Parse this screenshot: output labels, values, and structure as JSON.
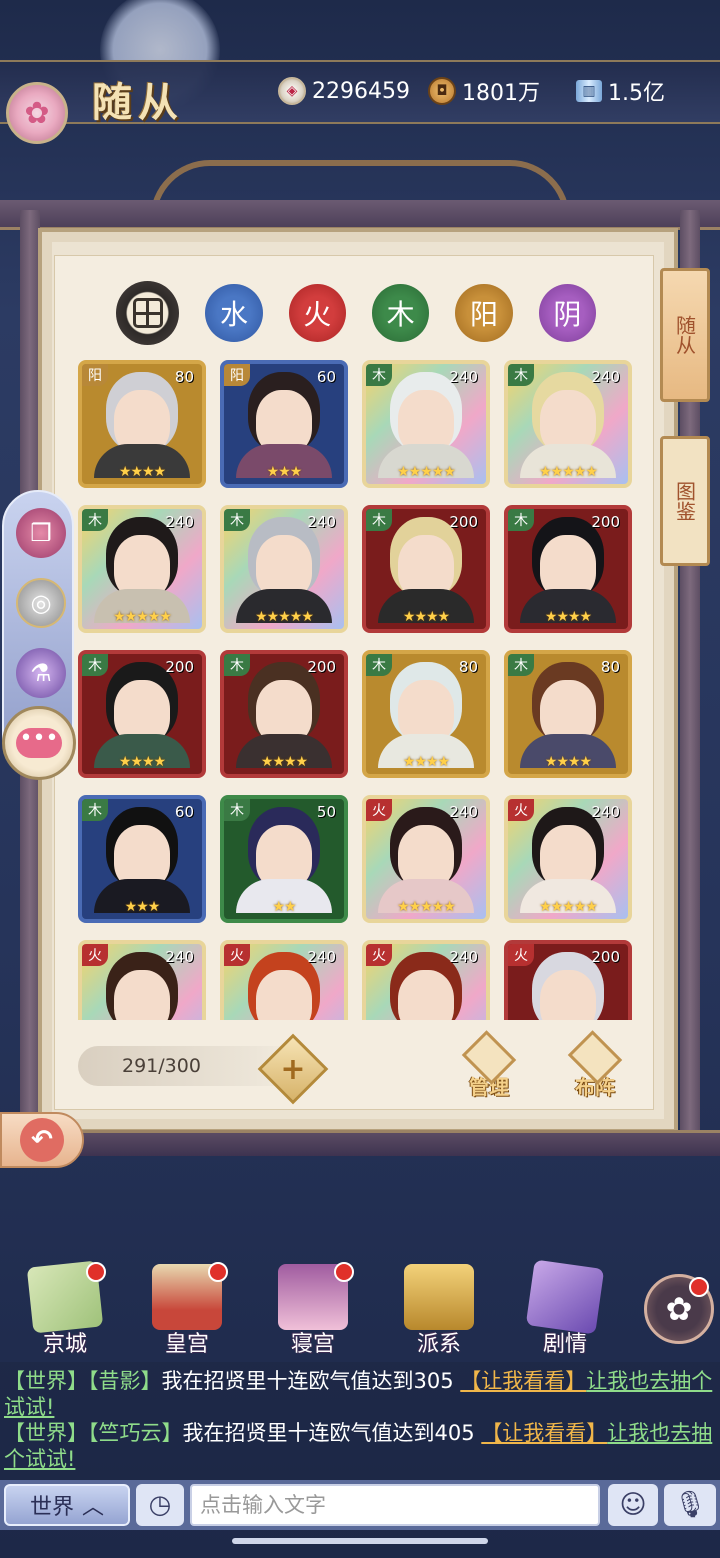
{
  "header": {
    "title": "随从",
    "resources": [
      {
        "icon": "yuanbao-icon",
        "value": "2296459"
      },
      {
        "icon": "copper-coin-icon",
        "value": "1801万"
      },
      {
        "icon": "book-icon",
        "value": "1.5亿"
      }
    ]
  },
  "filters": [
    {
      "id": "all",
      "label": ""
    },
    {
      "id": "water",
      "label": "水"
    },
    {
      "id": "fire",
      "label": "火"
    },
    {
      "id": "wood",
      "label": "木"
    },
    {
      "id": "yang",
      "label": "阳"
    },
    {
      "id": "yin",
      "label": "阴"
    }
  ],
  "side_tabs": {
    "retinue": "随从",
    "atlas": "图鉴"
  },
  "heroes": [
    {
      "element": "阳",
      "level": "80",
      "stars": "★★★★",
      "frame": "gold",
      "hair": "#cfcfd4",
      "robe": "#3a3a3a"
    },
    {
      "element": "阳",
      "level": "60",
      "stars": "★★★",
      "frame": "blue",
      "hair": "#2a1f1f",
      "robe": "#7a4a6a"
    },
    {
      "element": "木",
      "level": "240",
      "stars": "★★★★★",
      "frame": "rainbow",
      "hair": "#e8ecec",
      "robe": "#d8d8d0"
    },
    {
      "element": "木",
      "level": "240",
      "stars": "★★★★★",
      "frame": "rainbow",
      "hair": "#e6d9a0",
      "robe": "#e8e4d8"
    },
    {
      "element": "木",
      "level": "240",
      "stars": "★★★★★",
      "frame": "rainbow",
      "hair": "#1f1a1a",
      "robe": "#c8c0b0"
    },
    {
      "element": "木",
      "level": "240",
      "stars": "★★★★★",
      "frame": "rainbow",
      "hair": "#b8bcc4",
      "robe": "#2a2a2e"
    },
    {
      "element": "木",
      "level": "200",
      "stars": "★★★★",
      "frame": "red",
      "hair": "#e2d29a",
      "robe": "#2a2a2a"
    },
    {
      "element": "木",
      "level": "200",
      "stars": "★★★★",
      "frame": "red",
      "hair": "#141418",
      "robe": "#2a2a30"
    },
    {
      "element": "木",
      "level": "200",
      "stars": "★★★★",
      "frame": "red",
      "hair": "#1a1a1a",
      "robe": "#3a5a4a"
    },
    {
      "element": "木",
      "level": "200",
      "stars": "★★★★",
      "frame": "red",
      "hair": "#4a3022",
      "robe": "#3a3030"
    },
    {
      "element": "木",
      "level": "80",
      "stars": "★★★★",
      "frame": "gold",
      "hair": "#dfe8e8",
      "robe": "#e8e8e0"
    },
    {
      "element": "木",
      "level": "80",
      "stars": "★★★★",
      "frame": "gold",
      "hair": "#6a3a22",
      "robe": "#4a4a6a"
    },
    {
      "element": "木",
      "level": "60",
      "stars": "★★★",
      "frame": "blue",
      "hair": "#111111",
      "robe": "#1a1a22"
    },
    {
      "element": "木",
      "level": "50",
      "stars": "★★",
      "frame": "green",
      "hair": "#2a2a5a",
      "robe": "#e8e8ee"
    },
    {
      "element": "火",
      "level": "240",
      "stars": "★★★★★",
      "frame": "rainbow",
      "hair": "#2a1a1a",
      "robe": "#e6c8c8"
    },
    {
      "element": "火",
      "level": "240",
      "stars": "★★★★★",
      "frame": "rainbow",
      "hair": "#1e1818",
      "robe": "#f0e8e0"
    },
    {
      "element": "火",
      "level": "240",
      "stars": "",
      "frame": "rainbow",
      "hair": "#3a2218",
      "robe": "#d8b890"
    },
    {
      "element": "火",
      "level": "240",
      "stars": "",
      "frame": "rainbow",
      "hair": "#c4421e",
      "robe": "#7a2a1a"
    },
    {
      "element": "火",
      "level": "240",
      "stars": "",
      "frame": "rainbow",
      "hair": "#8a2a1a",
      "robe": "#3a1a1a"
    },
    {
      "element": "火",
      "level": "200",
      "stars": "",
      "frame": "red",
      "hair": "#d8d8e0",
      "robe": "#5a3a5a"
    }
  ],
  "capacity": "291/300",
  "actions": {
    "manage": "管理",
    "formation": "布阵"
  },
  "nav": [
    {
      "label": "京城",
      "icon": "map-icon",
      "badge": true
    },
    {
      "label": "皇宫",
      "icon": "palace-icon",
      "badge": true
    },
    {
      "label": "寝宫",
      "icon": "chamber-icon",
      "badge": true
    },
    {
      "label": "派系",
      "icon": "faction-icon",
      "badge": false
    },
    {
      "label": "剧情",
      "icon": "story-icon",
      "badge": false
    }
  ],
  "chat": {
    "lines": [
      {
        "channel": "【世界】",
        "user": "【昔影】",
        "message": "我在招贤里十连欧气值达到305",
        "link": "【让我看看】",
        "tail": "让我也去抽个试试!"
      },
      {
        "channel": "【世界】",
        "user": "【竺巧云】",
        "message": "我在招贤里十连欧气值达到405",
        "link": "【让我看看】",
        "tail": "让我也去抽个试试!"
      }
    ]
  },
  "input_bar": {
    "channel": "世界",
    "placeholder": "点击输入文字"
  }
}
